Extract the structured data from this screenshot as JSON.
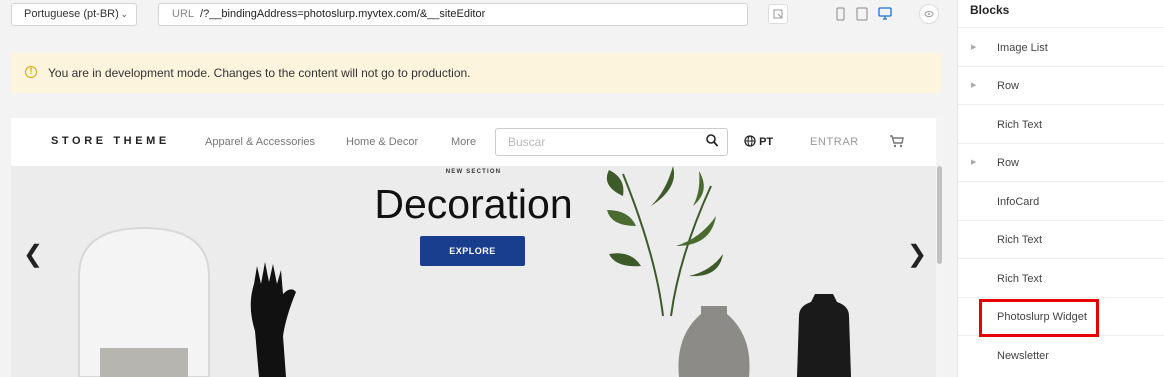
{
  "toolbar": {
    "locale": "Portuguese (pt-BR)",
    "url_label": "URL",
    "url_value": "/?__bindingAddress=photoslurp.myvtex.com/&__siteEditor",
    "icons": [
      "cursor-select-icon",
      "mobile-icon",
      "tablet-icon",
      "desktop-icon",
      "eye-icon"
    ],
    "active_color": "#1a6ee0"
  },
  "banner": {
    "message": "You are in development mode. Changes to the content will not go to production.",
    "color": "#fdf4de"
  },
  "store": {
    "brand": "STORE THEME",
    "nav": [
      "Apparel & Accessories",
      "Home & Decor",
      "More"
    ],
    "search_placeholder": "Buscar",
    "language": "PT",
    "login": "ENTRAR"
  },
  "hero": {
    "kicker": "NEW SECTION",
    "headline": "Decoration",
    "cta": "EXPLORE",
    "cta_color": "#1a3e8e"
  },
  "sidebar": {
    "title": "Blocks",
    "items": [
      {
        "label": "Image List",
        "expandable": true
      },
      {
        "label": "Row",
        "expandable": true
      },
      {
        "label": "Rich Text",
        "expandable": false
      },
      {
        "label": "Row",
        "expandable": true
      },
      {
        "label": "InfoCard",
        "expandable": false
      },
      {
        "label": "Rich Text",
        "expandable": false
      },
      {
        "label": "Rich Text",
        "expandable": false
      },
      {
        "label": "Photoslurp Widget",
        "expandable": false,
        "highlighted": true
      },
      {
        "label": "Newsletter",
        "expandable": false
      }
    ],
    "highlight_color": "#e60000"
  }
}
